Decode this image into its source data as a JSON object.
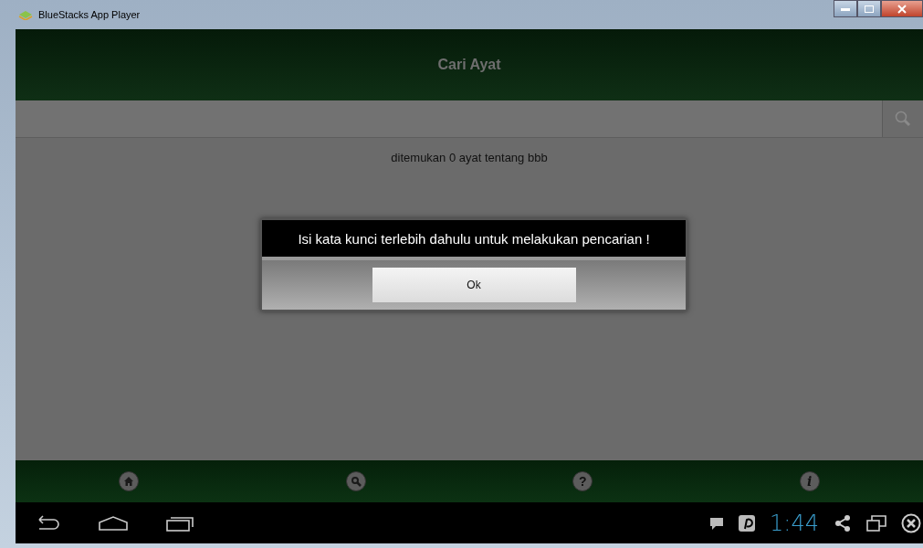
{
  "window": {
    "title": "BlueStacks App Player"
  },
  "header": {
    "title": "Cari Ayat"
  },
  "result": "ditemukan 0 ayat tentang bbb",
  "dialog": {
    "message": "Isi kata kunci terlebih dahulu untuk melakukan pencarian !",
    "button": "Ok"
  },
  "bottom_nav": [
    {
      "kind": "home"
    },
    {
      "kind": "search"
    },
    {
      "kind": "glyph",
      "glyph": "?"
    },
    {
      "kind": "glyph",
      "glyph": "i"
    }
  ],
  "system_bar": {
    "time": "1:44"
  }
}
